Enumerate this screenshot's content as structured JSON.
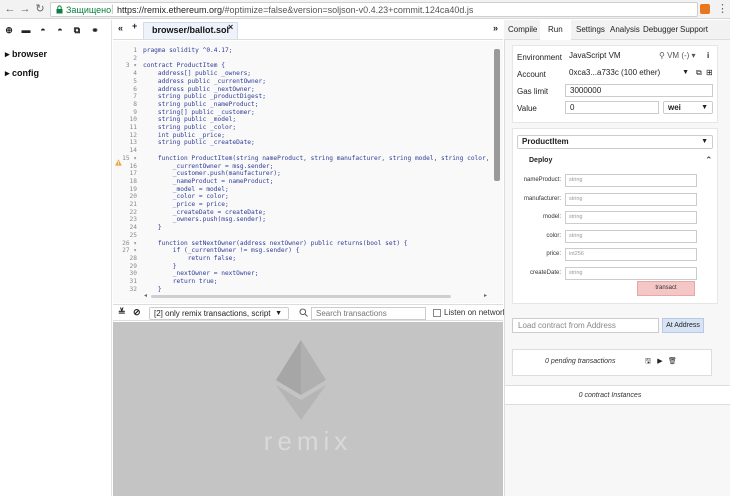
{
  "browser": {
    "secure_label": "Защищено",
    "url_host": "https://remix.ethereum.org",
    "url_rest": "/#optimize=false&version=soljson-v0.4.23+commit.124ca40d.js"
  },
  "file_panel": {
    "folders": [
      {
        "label": "browser"
      },
      {
        "label": "config"
      }
    ]
  },
  "editor": {
    "tab_label": "browser/ballot.sol",
    "tab_close": "×",
    "expand_left": "«",
    "expand_right": "»",
    "plus": "+",
    "lines": [
      {
        "n": "1",
        "code": "pragma solidity ^0.4.17;"
      },
      {
        "n": "2",
        "code": ""
      },
      {
        "n": "3 ▾",
        "code": "contract ProductItem {"
      },
      {
        "n": "4",
        "code": "    address[] public _owners;"
      },
      {
        "n": "5",
        "code": "    address public _currentOwner;"
      },
      {
        "n": "6",
        "code": "    address public _nextOwner;"
      },
      {
        "n": "7",
        "code": "    string public _productDigest;"
      },
      {
        "n": "8",
        "code": "    string public _nameProduct;"
      },
      {
        "n": "9",
        "code": "    string[] public _customer;"
      },
      {
        "n": "10",
        "code": "    string public _model;"
      },
      {
        "n": "11",
        "code": "    string public _color;"
      },
      {
        "n": "12",
        "code": "    int public _price;"
      },
      {
        "n": "13",
        "code": "    string public _createDate;"
      },
      {
        "n": "14",
        "code": ""
      },
      {
        "n": "15 ▾",
        "code": "    function ProductItem(string nameProduct, string manufacturer, string model, string color,"
      },
      {
        "n": "16",
        "code": "        _currentOwner = msg.sender;"
      },
      {
        "n": "17",
        "code": "        _customer.push(manufacturer);"
      },
      {
        "n": "18",
        "code": "        _nameProduct = nameProduct;"
      },
      {
        "n": "19",
        "code": "        _model = model;"
      },
      {
        "n": "20",
        "code": "        _color = color;"
      },
      {
        "n": "21",
        "code": "        _price = price;"
      },
      {
        "n": "22",
        "code": "        _createDate = createDate;"
      },
      {
        "n": "23",
        "code": "        _owners.push(msg.sender);"
      },
      {
        "n": "24",
        "code": "    }"
      },
      {
        "n": "25",
        "code": ""
      },
      {
        "n": "26 ▾",
        "code": "    function setNextOwner(address nextOwner) public returns(bool set) {"
      },
      {
        "n": "27 ▾",
        "code": "        if (_currentOwner != msg.sender) {"
      },
      {
        "n": "28",
        "code": "            return false;"
      },
      {
        "n": "29",
        "code": "        }"
      },
      {
        "n": "30",
        "code": "        _nextOwner = nextOwner;"
      },
      {
        "n": "31",
        "code": "        return true;"
      },
      {
        "n": "32",
        "code": "    }"
      }
    ]
  },
  "terminal": {
    "filter_label": "[2] only remix transactions, script",
    "search_placeholder": "Search transactions",
    "listen_label": "Listen on network",
    "logo_text": "remix"
  },
  "right_tabs": [
    {
      "label": "Compile"
    },
    {
      "label": "Run"
    },
    {
      "label": "Settings"
    },
    {
      "label": "Analysis"
    },
    {
      "label": "Debugger"
    },
    {
      "label": "Support"
    }
  ],
  "run": {
    "environment_label": "Environment",
    "environment_value": "JavaScript VM",
    "vm_label": "VM (-)",
    "info": "i",
    "account_label": "Account",
    "account_value": "0xca3...a733c (100 ether)",
    "gas_label": "Gas limit",
    "gas_value": "3000000",
    "value_label": "Value",
    "value_value": "0",
    "unit_value": "wei",
    "contract_value": "ProductItem",
    "deploy_label": "Deploy",
    "params": [
      {
        "name": "nameProduct:",
        "type": "string"
      },
      {
        "name": "manufacturer:",
        "type": "string"
      },
      {
        "name": "model:",
        "type": "string"
      },
      {
        "name": "color:",
        "type": "string"
      },
      {
        "name": "price:",
        "type": "int256"
      },
      {
        "name": "createDate:",
        "type": "string"
      }
    ],
    "transact_label": "transact",
    "load_placeholder": "Load contract from Address",
    "at_address_label": "At Address",
    "pending_label": "0 pending transactions",
    "instances_label": "0 contract Instances"
  }
}
